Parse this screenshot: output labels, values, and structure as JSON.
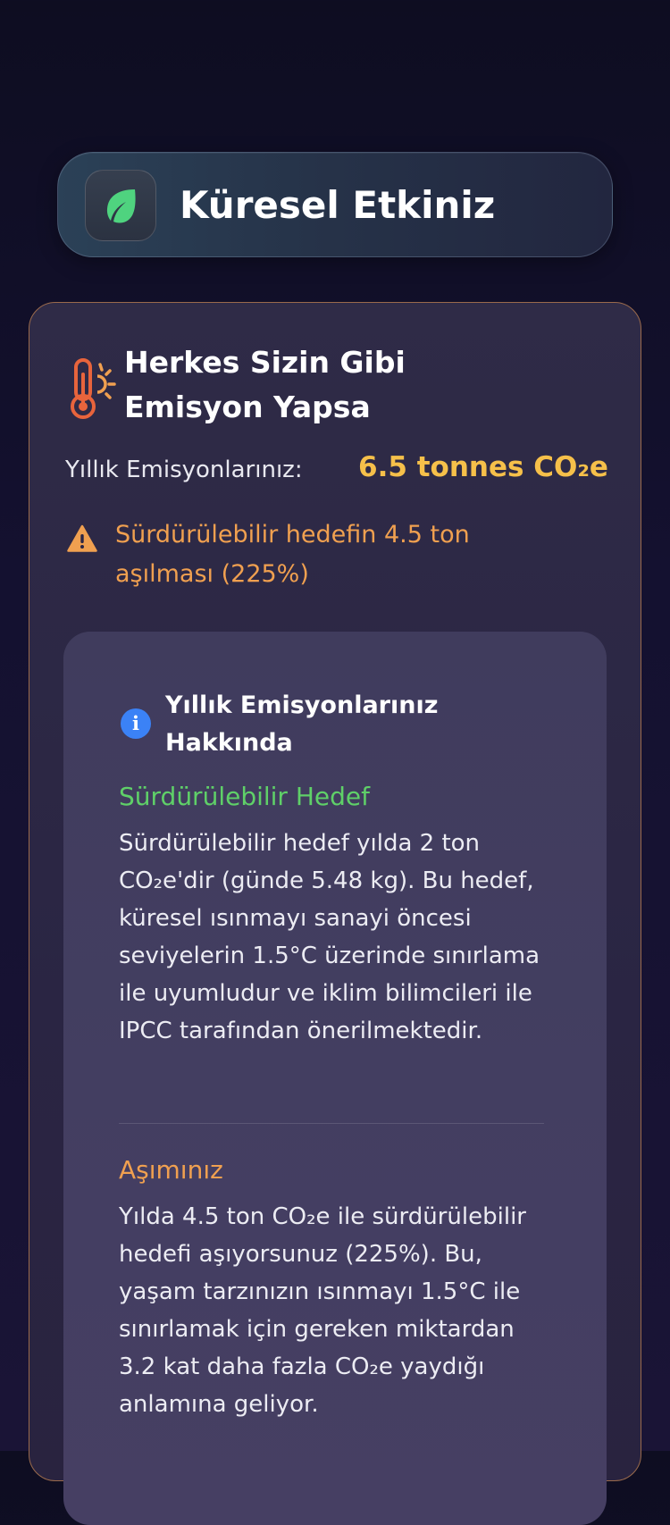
{
  "header": {
    "title": "Küresel Etkiniz",
    "icon": "leaf-icon",
    "accent_color": "#4fd37f"
  },
  "card": {
    "icon": "thermometer-sun-icon",
    "title": "Herkes Sizin Gibi Emisyon Yapsa",
    "emission_label": "Yıllık Emisyonlarınız:",
    "emission_value": "6.5 tonnes CO₂e",
    "warning_icon": "warning-triangle-icon",
    "warning_text": "Sürdürülebilir hedefin 4.5 ton aşılması (225%)",
    "border_color": "#9a6a4c",
    "value_color": "#f6c04a",
    "warning_color": "#f0a050"
  },
  "info": {
    "icon": "info-icon",
    "title": "Yıllık Emisyonlarınız Hakkında",
    "target_title": "Sürdürülebilir Hedef",
    "target_text": "Sürdürülebilir hedef yılda 2 ton CO₂e'dir (günde 5.48 kg). Bu hedef, küresel ısınmayı sanayi öncesi seviyelerin 1.5°C üzerinde sınırlama ile uyumludur ve iklim bilimcileri ile IPCC tarafından önerilmektedir.",
    "excess_title": "Aşımınız",
    "excess_text": "Yılda 4.5 ton CO₂e ile sürdürülebilir hedefi aşıyorsunuz (225%). Bu, yaşam tarzınızın ısınmayı 1.5°C ile sınırlamak için gereken miktardan 3.2 kat daha fazla CO₂e yaydığı anlamına geliyor.",
    "target_color": "#5fd068",
    "info_color": "#3b82f6"
  }
}
